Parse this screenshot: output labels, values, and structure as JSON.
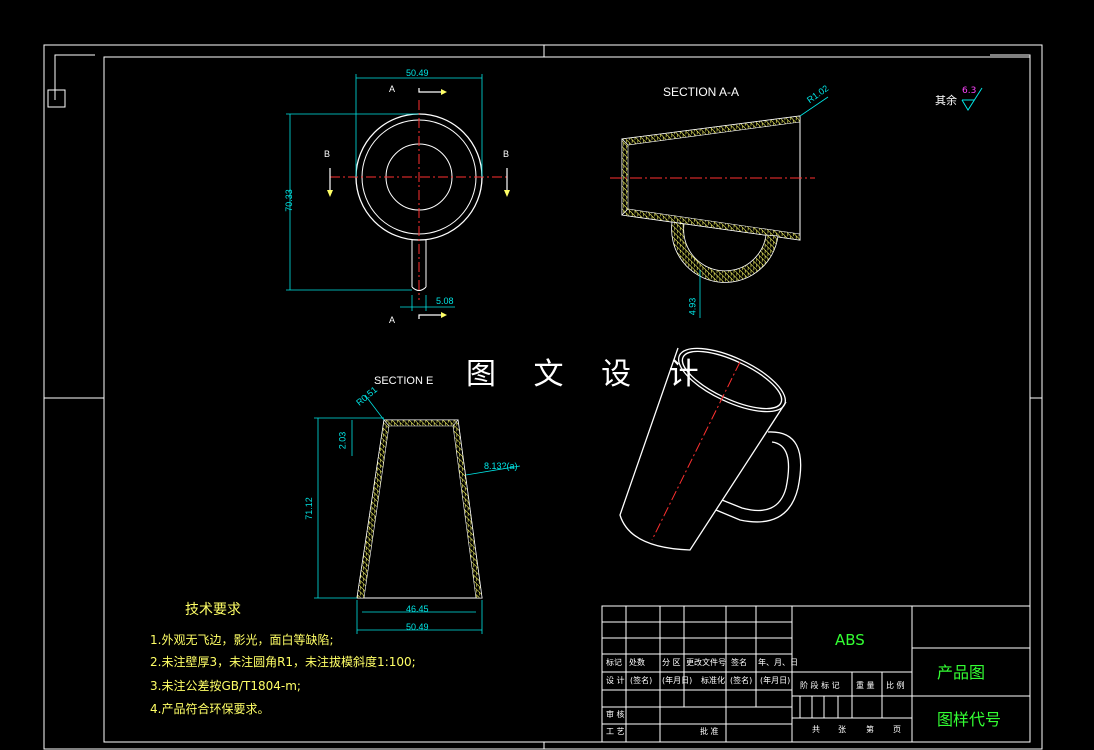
{
  "watermark": "图 文 设 计",
  "views": {
    "top": {
      "dim_width": "50.49",
      "dim_height": "70.33",
      "dim_handle": "5.08",
      "cut_a_top": "A",
      "cut_a_bottom": "A",
      "cut_b_left": "B",
      "cut_b_right": "B"
    },
    "section_aa": {
      "title": "SECTION A-A",
      "dim_radius": "R1.02",
      "dim_handle_thick": "4.93"
    },
    "section_e": {
      "title": "SECTION E",
      "dim_corner": "R0.51",
      "dim_top": "2.03",
      "dim_height": "71.12",
      "dim_angle": "8.13?(a)",
      "dim_inner_bottom": "46.45",
      "dim_outer_bottom": "50.49"
    }
  },
  "surface_finish": {
    "label": "其余",
    "value": "6.3"
  },
  "tech_requirements": {
    "title": "技术要求",
    "items": [
      "1.外观无飞边，影光，面白等缺陷;",
      "2.未注壁厚3，未注圆角R1，未注拔模斜度1:100;",
      "3.未注公差按GB/T1804-m;",
      "4.产品符合环保要求。"
    ]
  },
  "title_block": {
    "material": "ABS",
    "product_drawing": "产品图",
    "drawing_code": "图样代号",
    "row_labels": [
      "标记",
      "处数",
      "分 区",
      "更改文件号",
      "签名",
      "年、月、日"
    ],
    "row_design": [
      "设 计",
      "(签名)",
      "(年月日)",
      "标准化",
      "(签名)",
      "(年月日)"
    ],
    "stage_labels": [
      "阶 段 标 记",
      "重 量",
      "比 例"
    ],
    "row_review": "审 核",
    "row_process": "工 艺",
    "approve": "批 准",
    "pages": [
      "共",
      "张",
      "第",
      "页"
    ]
  },
  "colors": {
    "frame": "#ffffff",
    "dimension": "#00e5e5",
    "centerline": "#ff3030",
    "hatch": "#ffff66",
    "title_text": "#33ff33",
    "note_text": "#ffff66",
    "finish": "#ff44ff"
  }
}
